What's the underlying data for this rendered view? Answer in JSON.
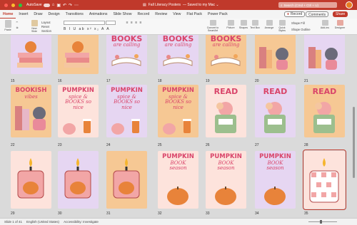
{
  "window": {
    "autosave_label": "AutoSave",
    "doc_title": "Fall Literacy Posters",
    "save_state": "— Saved to my Mac ⌄",
    "search_placeholder": "Search (Cmd + Ctrl + U)"
  },
  "tabs": [
    "Home",
    "Insert",
    "Draw",
    "Design",
    "Transitions",
    "Animations",
    "Slide Show",
    "Record",
    "Review",
    "View",
    "Flat Pack",
    "Power Pack"
  ],
  "active_tab": "Home",
  "actions": {
    "record": "Record",
    "comments": "Comments",
    "share": "Share"
  },
  "ribbon": {
    "paste": "Paste",
    "new_slide": "New Slide",
    "layout": "Layout",
    "reset": "Reset",
    "section": "Section",
    "format_row": "B I U ab x² x₂ A A",
    "convert_smartart": "Convert to SmartArt",
    "picture": "Picture",
    "shapes": "Shapes",
    "text_box": "Text Box",
    "arrange": "Arrange",
    "quick_styles": "Quick Styles",
    "shape_fill": "Shape Fill",
    "shape_outline": "Shape Outline",
    "add_ins": "Add-ins",
    "designer": "Designer"
  },
  "slides": [
    {
      "num": "15",
      "bg": "#e6d6f2",
      "title": "",
      "sub": ""
    },
    {
      "num": "16",
      "bg": "#f6c894",
      "title": "",
      "sub": ""
    },
    {
      "num": "17",
      "bg": "#e6d6f2",
      "title": "BOOKS",
      "sub": "are calling"
    },
    {
      "num": "18",
      "bg": "#e6d6f2",
      "title": "BOOKS",
      "sub": "are calling"
    },
    {
      "num": "19",
      "bg": "#f6c894",
      "title": "BOOKS",
      "sub": "are calling"
    },
    {
      "num": "20",
      "bg": "#f6c894",
      "title": "",
      "sub": ""
    },
    {
      "num": "21",
      "bg": "#e6d6f2",
      "title": "",
      "sub": ""
    },
    {
      "num": "22",
      "bg": "#f6c894",
      "title": "BOOKISH",
      "sub": "vibes"
    },
    {
      "num": "23",
      "bg": "#fde3dc",
      "title": "PUMPKIN",
      "sub": "spice & BOOKS so nice"
    },
    {
      "num": "24",
      "bg": "#e6d6f2",
      "title": "PUMPKIN",
      "sub": "spice & BOOKS so nice"
    },
    {
      "num": "25",
      "bg": "#f6c894",
      "title": "PUMPKIN",
      "sub": "spice & BOOKS so nice"
    },
    {
      "num": "26",
      "bg": "#fde3dc",
      "title": "READ",
      "sub": ""
    },
    {
      "num": "27",
      "bg": "#e6d6f2",
      "title": "READ",
      "sub": ""
    },
    {
      "num": "28",
      "bg": "#f6c894",
      "title": "READ",
      "sub": ""
    },
    {
      "num": "29",
      "bg": "#fde3dc",
      "title": "",
      "sub": ""
    },
    {
      "num": "30",
      "bg": "#e6d6f2",
      "title": "",
      "sub": ""
    },
    {
      "num": "31",
      "bg": "#f6c894",
      "title": "",
      "sub": ""
    },
    {
      "num": "32",
      "bg": "#fde3dc",
      "title": "PUMPKIN",
      "sub": "BOOK season"
    },
    {
      "num": "33",
      "bg": "#fde3dc",
      "title": "PUMPKIN",
      "sub": "BOOK season"
    },
    {
      "num": "34",
      "bg": "#e6d6f2",
      "title": "PUMPKIN",
      "sub": "BOOK season"
    },
    {
      "num": "35",
      "bg": "#fde3dc",
      "title": "",
      "sub": ""
    }
  ],
  "status": {
    "slide_of": "Slide 1 of 41",
    "language": "English (United States)",
    "accessibility": "Accessibility: Investigate"
  },
  "colors": {
    "accent": "#c0392b",
    "title_pink": "#d9456a",
    "lavender": "#e6d6f2",
    "peach": "#f6c894",
    "blush": "#fde3dc"
  }
}
